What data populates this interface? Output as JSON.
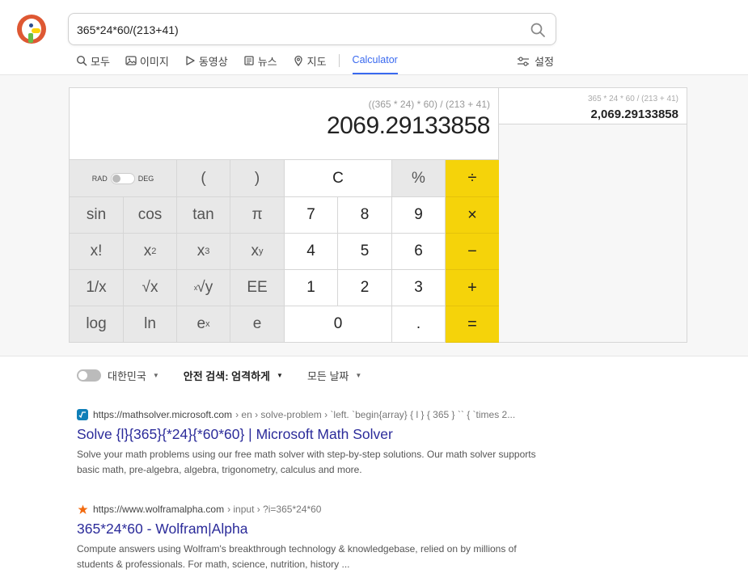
{
  "search": {
    "query": "365*24*60/(213+41)"
  },
  "tabs": [
    {
      "label": "모두",
      "icon": "search-icon"
    },
    {
      "label": "이미지",
      "icon": "image-icon"
    },
    {
      "label": "동영상",
      "icon": "play-icon"
    },
    {
      "label": "뉴스",
      "icon": "news-icon"
    },
    {
      "label": "지도",
      "icon": "map-pin-icon"
    },
    {
      "label": "Calculator",
      "active": true
    }
  ],
  "settings_label": "설정",
  "calculator": {
    "expression": "((365 * 24) * 60) / (213 + 41)",
    "result": "2069.29133858",
    "rad_label": "RAD",
    "deg_label": "DEG",
    "keys": {
      "lparen": "(",
      "rparen": ")",
      "clear": "C",
      "percent": "%",
      "divide": "÷",
      "sin": "sin",
      "cos": "cos",
      "tan": "tan",
      "pi": "π",
      "k7": "7",
      "k8": "8",
      "k9": "9",
      "multiply": "×",
      "fact": "x!",
      "x_base": "x",
      "sq_exp": "2",
      "cube_exp": "3",
      "y_exp": "y",
      "k4": "4",
      "k5": "5",
      "k6": "6",
      "minus": "−",
      "recip": "1/x",
      "sqrt": "√x",
      "root_pre": "x",
      "root": "√y",
      "ee": "EE",
      "k1": "1",
      "k2": "2",
      "k3": "3",
      "plus": "+",
      "log": "log",
      "ln": "ln",
      "e_base": "e",
      "ex_exp": "x",
      "e": "e",
      "k0": "0",
      "dot": ".",
      "equals": "="
    }
  },
  "history": {
    "expression": "365 * 24 * 60 / (213 + 41)",
    "result": "2,069.29133858"
  },
  "filters": {
    "region": "대한민국",
    "safe_search_prefix": "안전 검색:",
    "safe_search_value": "엄격하게",
    "date": "모든 날짜"
  },
  "results": [
    {
      "domain": "https://mathsolver.microsoft.com",
      "path": "› en › solve-problem › `left. `begin{array} { l } { 365 } `` { `times 2...",
      "title": "Solve {l}{365}{*24}{*60*60} | Microsoft Math Solver",
      "snippet": "Solve your math problems using our free math solver with step-by-step solutions. Our math solver supports basic math, pre-algebra, algebra, trigonometry, calculus and more.",
      "favicon_color": "#0f7fb8"
    },
    {
      "domain": "https://www.wolframalpha.com",
      "path": "› input › ?i=365*24*60",
      "title": "365*24*60 - Wolfram|Alpha",
      "snippet": "Compute answers using Wolfram's breakthrough technology & knowledgebase, relied on by millions of students & professionals. For math, science, nutrition, history ...",
      "favicon_color": "#f26a0f"
    }
  ]
}
